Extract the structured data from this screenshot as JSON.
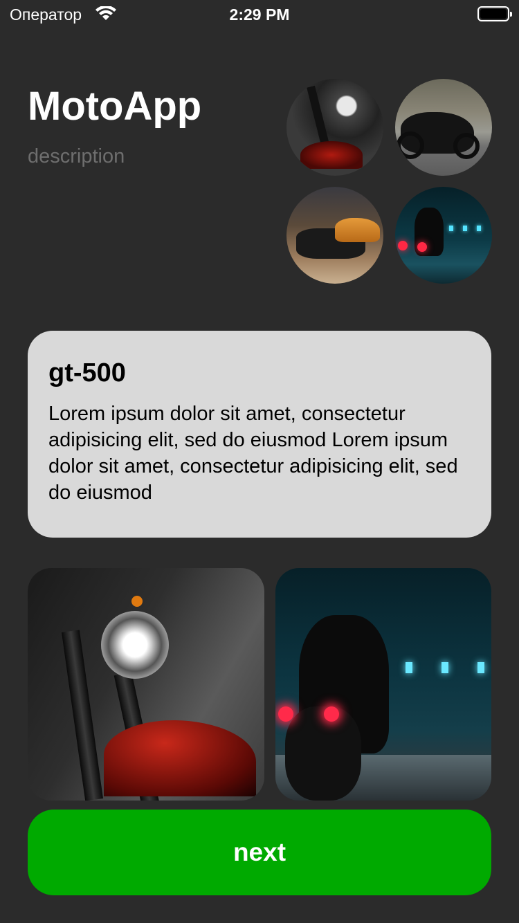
{
  "status_bar": {
    "carrier": "Оператор",
    "time": "2:29 PM"
  },
  "header": {
    "title": "MotoApp",
    "description": "description"
  },
  "thumbnails": [
    {
      "name": "motorcycle-headlight-photo"
    },
    {
      "name": "rider-on-road-photo"
    },
    {
      "name": "orange-motorcycle-photo"
    },
    {
      "name": "night-rider-photo"
    }
  ],
  "card": {
    "title": "gt-500",
    "body": "Lorem ipsum dolor sit amet, consectetur adipisicing elit, sed do eiusmod Lorem ipsum dolor sit amet, consectetur adipisicing elit, sed do eiusmod"
  },
  "next_button": {
    "label": "next"
  },
  "colors": {
    "background": "#2b2b2b",
    "card": "#d9d9d9",
    "accent": "#00aa00",
    "description": "#6e6e6e"
  },
  "icons": [
    "wifi-icon",
    "battery-icon"
  ]
}
